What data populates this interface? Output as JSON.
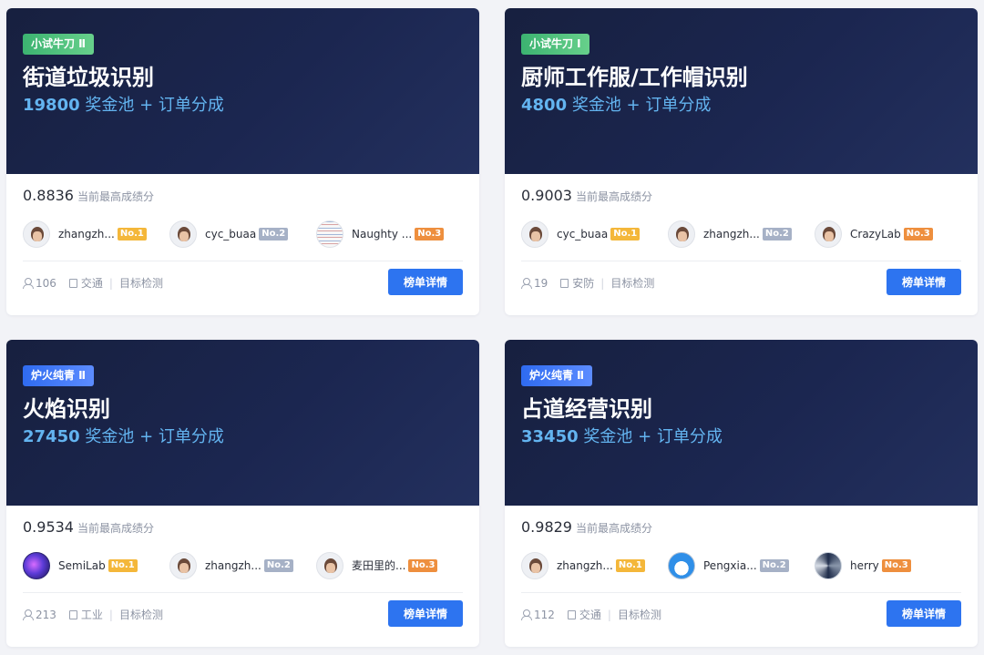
{
  "ui": {
    "score_label": "当前最高成绩分",
    "detail_button": "榜单详情",
    "prize_suffix": " 奖金池 + 订单分成"
  },
  "cards": [
    {
      "badge": "小试牛刀 Ⅱ",
      "badge_color": "green",
      "title": "街道垃圾识别",
      "prize": "19800",
      "score": "0.8836",
      "leaders": [
        {
          "name": "zhangzh...",
          "rank": "No.1",
          "avatar": "person"
        },
        {
          "name": "cyc_buaa",
          "rank": "No.2",
          "avatar": "person"
        },
        {
          "name": "Naughty ...",
          "rank": "No.3",
          "avatar": "text"
        }
      ],
      "participants": "106",
      "category": "交通",
      "task": "目标检测"
    },
    {
      "badge": "小试牛刀 Ⅰ",
      "badge_color": "green",
      "title": "厨师工作服/工作帽识别",
      "prize": "4800",
      "score": "0.9003",
      "leaders": [
        {
          "name": "cyc_buaa",
          "rank": "No.1",
          "avatar": "person"
        },
        {
          "name": "zhangzh...",
          "rank": "No.2",
          "avatar": "person"
        },
        {
          "name": "CrazyLab",
          "rank": "No.3",
          "avatar": "person"
        }
      ],
      "participants": "19",
      "category": "安防",
      "task": "目标检测"
    },
    {
      "badge": "炉火纯青 Ⅱ",
      "badge_color": "blue",
      "title": "火焰识别",
      "prize": "27450",
      "score": "0.9534",
      "leaders": [
        {
          "name": "SemiLab",
          "rank": "No.1",
          "avatar": "galaxy"
        },
        {
          "name": "zhangzh...",
          "rank": "No.2",
          "avatar": "person"
        },
        {
          "name": "麦田里的...",
          "rank": "No.3",
          "avatar": "person"
        }
      ],
      "participants": "213",
      "category": "工业",
      "task": "目标检测"
    },
    {
      "badge": "炉火纯青 Ⅱ",
      "badge_color": "blue",
      "title": "占道经营识别",
      "prize": "33450",
      "score": "0.9829",
      "leaders": [
        {
          "name": "zhangzh...",
          "rank": "No.1",
          "avatar": "person"
        },
        {
          "name": "Pengxia...",
          "rank": "No.2",
          "avatar": "doraemon"
        },
        {
          "name": "herry",
          "rank": "No.3",
          "avatar": "swirl"
        }
      ],
      "participants": "112",
      "category": "交通",
      "task": "目标检测"
    }
  ]
}
